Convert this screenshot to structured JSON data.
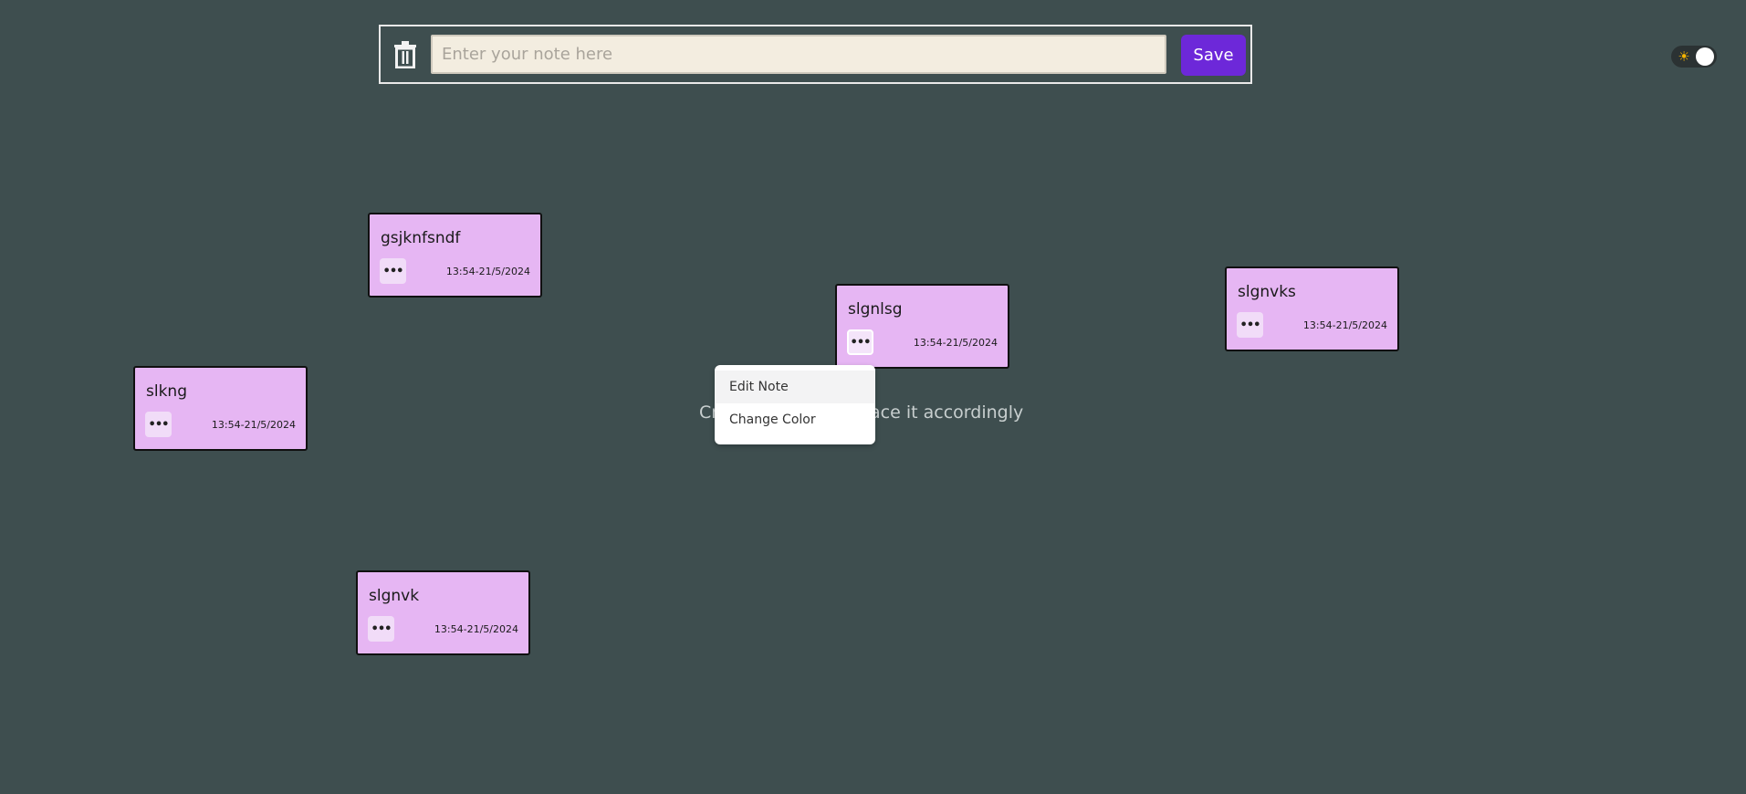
{
  "toolbar": {
    "delete_icon": "trash-icon",
    "input_placeholder": "Enter your note here",
    "input_value": "",
    "save_label": "Save"
  },
  "theme_toggle": {
    "icon": "sun-icon",
    "state": "dark"
  },
  "hint": {
    "text": "Create notes and place it accordingly"
  },
  "notes": [
    {
      "title": "gsjknfsndf",
      "timestamp": "13:54-21/5/2024",
      "menu_icon": "more-icon"
    },
    {
      "title": "slgnlsg",
      "timestamp": "13:54-21/5/2024",
      "menu_icon": "more-icon"
    },
    {
      "title": "slgnvks",
      "timestamp": "13:54-21/5/2024",
      "menu_icon": "more-icon"
    },
    {
      "title": "slkng",
      "timestamp": "13:54-21/5/2024",
      "menu_icon": "more-icon"
    },
    {
      "title": "slgnvk",
      "timestamp": "13:54-21/5/2024",
      "menu_icon": "more-icon"
    }
  ],
  "context_menu": {
    "items": [
      {
        "label": "Edit Note"
      },
      {
        "label": "Change Color"
      }
    ]
  },
  "colors": {
    "background": "#3e4e4f",
    "note_fill": "#e6b6f3",
    "save_button": "#6d28d9",
    "input_fill": "#f3ede0"
  }
}
